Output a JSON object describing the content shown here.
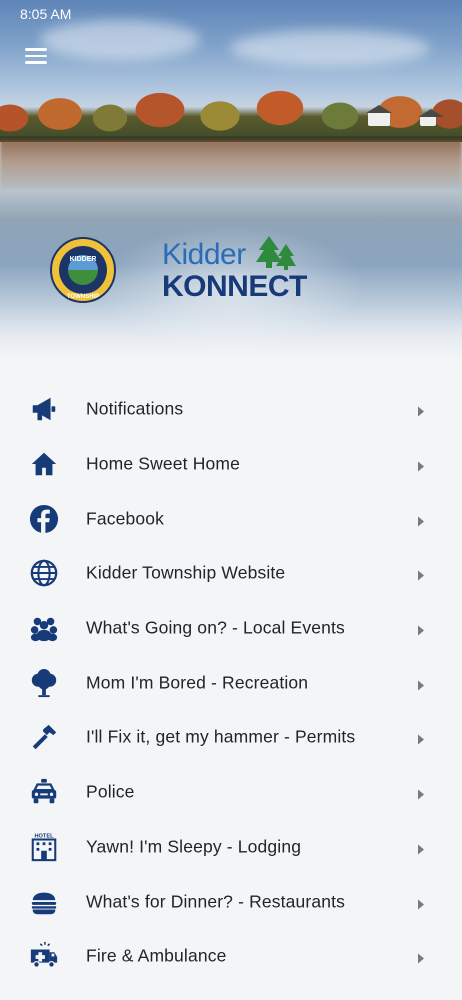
{
  "status_bar": {
    "time": "8:05 AM"
  },
  "header": {
    "menu_icon": "hamburger-menu-icon",
    "seal": {
      "top_text": "KIDDER",
      "bottom_text": "TOWNSHIP"
    },
    "brand": {
      "line1": "Kidder",
      "line2": "KONNECT"
    }
  },
  "colors": {
    "icon": "#173a78",
    "text": "#222427",
    "background": "#f4f5f7",
    "chevron": "#777b80",
    "brand_blue": "#2b6cb7",
    "brand_navy": "#173a78",
    "tree_green": "#2e8b3d"
  },
  "menu": [
    {
      "label": "Notifications",
      "icon": "megaphone-icon"
    },
    {
      "label": "Home Sweet Home",
      "icon": "house-icon"
    },
    {
      "label": "Facebook",
      "icon": "facebook-icon"
    },
    {
      "label": "Kidder Township Website",
      "icon": "globe-icon"
    },
    {
      "label": "What's Going on? - Local Events",
      "icon": "people-group-icon"
    },
    {
      "label": "Mom I'm Bored - Recreation",
      "icon": "tree-icon"
    },
    {
      "label": "I'll Fix it, get my hammer - Permits",
      "icon": "hammer-icon"
    },
    {
      "label": "Police",
      "icon": "police-car-icon"
    },
    {
      "label": "Yawn! I'm Sleepy - Lodging",
      "icon": "hotel-icon",
      "icon_text": "HOTEL"
    },
    {
      "label": "What's for Dinner? - Restaurants",
      "icon": "burger-icon"
    },
    {
      "label": "Fire & Ambulance",
      "icon": "ambulance-icon"
    }
  ]
}
